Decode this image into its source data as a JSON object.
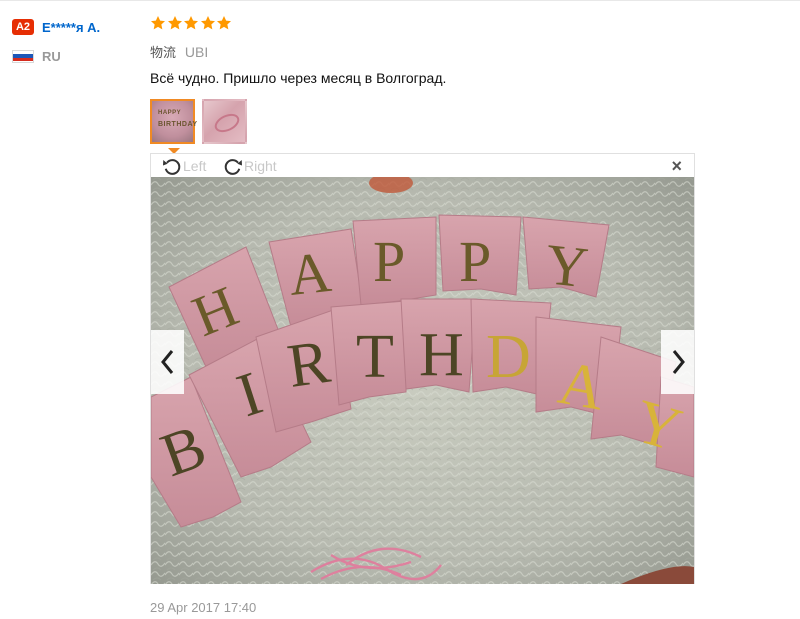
{
  "user": {
    "level_badge": "A2",
    "name": "E*****я A.",
    "country_code": "RU",
    "flag_icon": "russia-flag-icon"
  },
  "review": {
    "rating": 5,
    "star_color": "#ff9900",
    "logistics_label": "物流",
    "logistics_value": "UBI",
    "text": "Всё чудно. Пришло через месяц в Волгоград.",
    "timestamp": "29 Apr 2017 17:40"
  },
  "thumbnails": [
    {
      "name": "photo-1",
      "active": true
    },
    {
      "name": "photo-2",
      "active": false
    }
  ],
  "viewer": {
    "rotate_left_label": "Left",
    "rotate_right_label": "Right",
    "close_label": "×",
    "photo_letters_top": [
      "H",
      "A",
      "P",
      "P",
      "Y"
    ],
    "photo_letters_bottom": [
      "B",
      "I",
      "R",
      "T",
      "H",
      "D",
      "A",
      "Y"
    ]
  },
  "colors": {
    "accent": "#f08a24",
    "link": "#0066cc",
    "badge": "#e62e04"
  }
}
